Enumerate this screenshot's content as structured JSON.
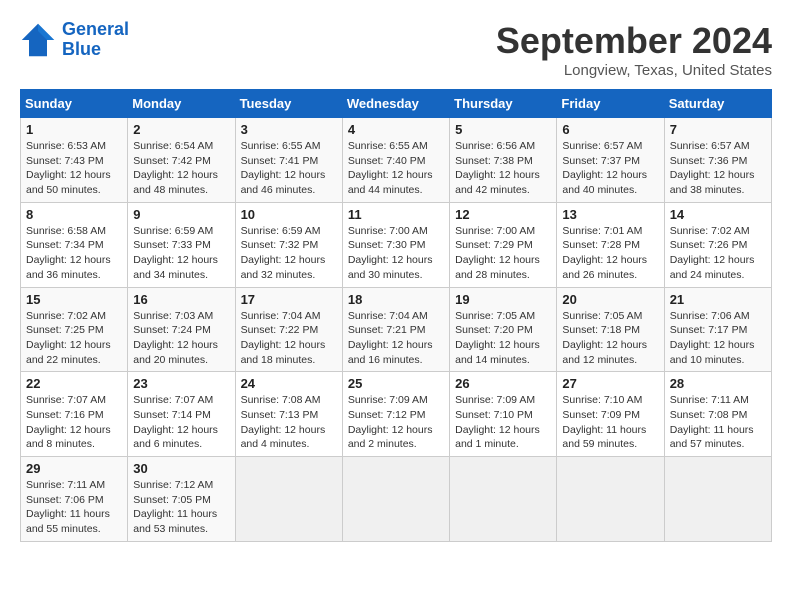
{
  "logo": {
    "name_line1": "General",
    "name_line2": "Blue"
  },
  "title": "September 2024",
  "subtitle": "Longview, Texas, United States",
  "days_of_week": [
    "Sunday",
    "Monday",
    "Tuesday",
    "Wednesday",
    "Thursday",
    "Friday",
    "Saturday"
  ],
  "weeks": [
    [
      {
        "day": "1",
        "sunrise": "Sunrise: 6:53 AM",
        "sunset": "Sunset: 7:43 PM",
        "daylight": "Daylight: 12 hours and 50 minutes."
      },
      {
        "day": "2",
        "sunrise": "Sunrise: 6:54 AM",
        "sunset": "Sunset: 7:42 PM",
        "daylight": "Daylight: 12 hours and 48 minutes."
      },
      {
        "day": "3",
        "sunrise": "Sunrise: 6:55 AM",
        "sunset": "Sunset: 7:41 PM",
        "daylight": "Daylight: 12 hours and 46 minutes."
      },
      {
        "day": "4",
        "sunrise": "Sunrise: 6:55 AM",
        "sunset": "Sunset: 7:40 PM",
        "daylight": "Daylight: 12 hours and 44 minutes."
      },
      {
        "day": "5",
        "sunrise": "Sunrise: 6:56 AM",
        "sunset": "Sunset: 7:38 PM",
        "daylight": "Daylight: 12 hours and 42 minutes."
      },
      {
        "day": "6",
        "sunrise": "Sunrise: 6:57 AM",
        "sunset": "Sunset: 7:37 PM",
        "daylight": "Daylight: 12 hours and 40 minutes."
      },
      {
        "day": "7",
        "sunrise": "Sunrise: 6:57 AM",
        "sunset": "Sunset: 7:36 PM",
        "daylight": "Daylight: 12 hours and 38 minutes."
      }
    ],
    [
      {
        "day": "8",
        "sunrise": "Sunrise: 6:58 AM",
        "sunset": "Sunset: 7:34 PM",
        "daylight": "Daylight: 12 hours and 36 minutes."
      },
      {
        "day": "9",
        "sunrise": "Sunrise: 6:59 AM",
        "sunset": "Sunset: 7:33 PM",
        "daylight": "Daylight: 12 hours and 34 minutes."
      },
      {
        "day": "10",
        "sunrise": "Sunrise: 6:59 AM",
        "sunset": "Sunset: 7:32 PM",
        "daylight": "Daylight: 12 hours and 32 minutes."
      },
      {
        "day": "11",
        "sunrise": "Sunrise: 7:00 AM",
        "sunset": "Sunset: 7:30 PM",
        "daylight": "Daylight: 12 hours and 30 minutes."
      },
      {
        "day": "12",
        "sunrise": "Sunrise: 7:00 AM",
        "sunset": "Sunset: 7:29 PM",
        "daylight": "Daylight: 12 hours and 28 minutes."
      },
      {
        "day": "13",
        "sunrise": "Sunrise: 7:01 AM",
        "sunset": "Sunset: 7:28 PM",
        "daylight": "Daylight: 12 hours and 26 minutes."
      },
      {
        "day": "14",
        "sunrise": "Sunrise: 7:02 AM",
        "sunset": "Sunset: 7:26 PM",
        "daylight": "Daylight: 12 hours and 24 minutes."
      }
    ],
    [
      {
        "day": "15",
        "sunrise": "Sunrise: 7:02 AM",
        "sunset": "Sunset: 7:25 PM",
        "daylight": "Daylight: 12 hours and 22 minutes."
      },
      {
        "day": "16",
        "sunrise": "Sunrise: 7:03 AM",
        "sunset": "Sunset: 7:24 PM",
        "daylight": "Daylight: 12 hours and 20 minutes."
      },
      {
        "day": "17",
        "sunrise": "Sunrise: 7:04 AM",
        "sunset": "Sunset: 7:22 PM",
        "daylight": "Daylight: 12 hours and 18 minutes."
      },
      {
        "day": "18",
        "sunrise": "Sunrise: 7:04 AM",
        "sunset": "Sunset: 7:21 PM",
        "daylight": "Daylight: 12 hours and 16 minutes."
      },
      {
        "day": "19",
        "sunrise": "Sunrise: 7:05 AM",
        "sunset": "Sunset: 7:20 PM",
        "daylight": "Daylight: 12 hours and 14 minutes."
      },
      {
        "day": "20",
        "sunrise": "Sunrise: 7:05 AM",
        "sunset": "Sunset: 7:18 PM",
        "daylight": "Daylight: 12 hours and 12 minutes."
      },
      {
        "day": "21",
        "sunrise": "Sunrise: 7:06 AM",
        "sunset": "Sunset: 7:17 PM",
        "daylight": "Daylight: 12 hours and 10 minutes."
      }
    ],
    [
      {
        "day": "22",
        "sunrise": "Sunrise: 7:07 AM",
        "sunset": "Sunset: 7:16 PM",
        "daylight": "Daylight: 12 hours and 8 minutes."
      },
      {
        "day": "23",
        "sunrise": "Sunrise: 7:07 AM",
        "sunset": "Sunset: 7:14 PM",
        "daylight": "Daylight: 12 hours and 6 minutes."
      },
      {
        "day": "24",
        "sunrise": "Sunrise: 7:08 AM",
        "sunset": "Sunset: 7:13 PM",
        "daylight": "Daylight: 12 hours and 4 minutes."
      },
      {
        "day": "25",
        "sunrise": "Sunrise: 7:09 AM",
        "sunset": "Sunset: 7:12 PM",
        "daylight": "Daylight: 12 hours and 2 minutes."
      },
      {
        "day": "26",
        "sunrise": "Sunrise: 7:09 AM",
        "sunset": "Sunset: 7:10 PM",
        "daylight": "Daylight: 12 hours and 1 minute."
      },
      {
        "day": "27",
        "sunrise": "Sunrise: 7:10 AM",
        "sunset": "Sunset: 7:09 PM",
        "daylight": "Daylight: 11 hours and 59 minutes."
      },
      {
        "day": "28",
        "sunrise": "Sunrise: 7:11 AM",
        "sunset": "Sunset: 7:08 PM",
        "daylight": "Daylight: 11 hours and 57 minutes."
      }
    ],
    [
      {
        "day": "29",
        "sunrise": "Sunrise: 7:11 AM",
        "sunset": "Sunset: 7:06 PM",
        "daylight": "Daylight: 11 hours and 55 minutes."
      },
      {
        "day": "30",
        "sunrise": "Sunrise: 7:12 AM",
        "sunset": "Sunset: 7:05 PM",
        "daylight": "Daylight: 11 hours and 53 minutes."
      },
      null,
      null,
      null,
      null,
      null
    ]
  ]
}
